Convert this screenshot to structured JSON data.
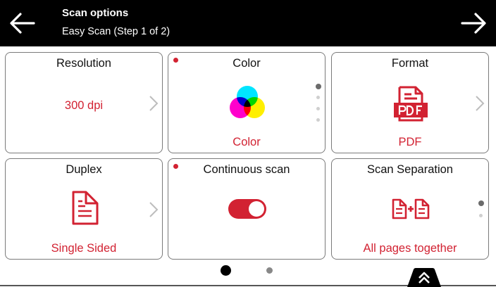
{
  "header": {
    "title": "Scan options",
    "subtitle": "Easy Scan (Step 1 of 2)",
    "back_icon": "arrow-left-icon",
    "next_icon": "arrow-right-icon"
  },
  "cards": {
    "resolution": {
      "title": "Resolution",
      "value": "300 dpi"
    },
    "color": {
      "title": "Color",
      "value": "Color",
      "icon": "cmy-color-icon",
      "options_count": 4,
      "selected_option": 1
    },
    "format": {
      "title": "Format",
      "value": "PDF",
      "icon": "pdf-document-icon"
    },
    "duplex": {
      "title": "Duplex",
      "value": "Single Sided",
      "icon": "single-sided-document-icon"
    },
    "continuous": {
      "title": "Continuous scan",
      "toggle_on": true
    },
    "separation": {
      "title": "Scan Separation",
      "value": "All pages together",
      "icon": "documents-merge-icon",
      "options_count": 2,
      "selected_option": 1
    }
  },
  "pagination": {
    "total_pages": 2,
    "current_page": 1
  },
  "colors": {
    "accent": "#d22232",
    "header_bg": "#000000",
    "border": "#7a7a7a"
  }
}
